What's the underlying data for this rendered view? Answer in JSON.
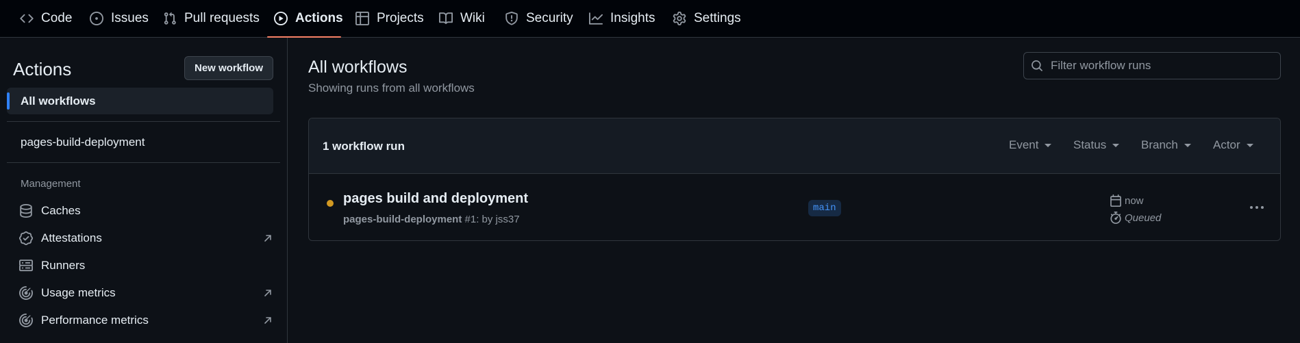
{
  "colors": {
    "background": "#0d1117",
    "nav_background": "#010409",
    "active_tab_underline": "#f78166",
    "active_sidebar_indicator": "#2f81f7",
    "queued_status": "#d29922",
    "branch_text": "#4493f8"
  },
  "nav": {
    "tabs": [
      {
        "label": "Code",
        "icon": "code-icon"
      },
      {
        "label": "Issues",
        "icon": "issue-icon"
      },
      {
        "label": "Pull requests",
        "icon": "pull-request-icon"
      },
      {
        "label": "Actions",
        "icon": "play-icon",
        "active": true
      },
      {
        "label": "Projects",
        "icon": "table-icon"
      },
      {
        "label": "Wiki",
        "icon": "book-icon"
      },
      {
        "label": "Security",
        "icon": "shield-icon"
      },
      {
        "label": "Insights",
        "icon": "graph-icon"
      },
      {
        "label": "Settings",
        "icon": "gear-icon"
      }
    ]
  },
  "sidebar": {
    "title": "Actions",
    "new_workflow_label": "New workflow",
    "all_workflows_label": "All workflows",
    "workflows": [
      "pages-build-deployment"
    ],
    "management_heading": "Management",
    "management_items": [
      {
        "label": "Caches",
        "icon": "database-icon",
        "external": false
      },
      {
        "label": "Attestations",
        "icon": "verified-icon",
        "external": true
      },
      {
        "label": "Runners",
        "icon": "server-icon",
        "external": false
      },
      {
        "label": "Usage metrics",
        "icon": "meter-icon",
        "external": true
      },
      {
        "label": "Performance metrics",
        "icon": "meter-icon",
        "external": true
      }
    ]
  },
  "main": {
    "title": "All workflows",
    "subtitle": "Showing runs from all workflows",
    "filter_placeholder": "Filter workflow runs",
    "runs_count_label": "1 workflow run",
    "filters": [
      "Event",
      "Status",
      "Branch",
      "Actor"
    ],
    "runs": [
      {
        "title": "pages build and deployment",
        "workflow": "pages-build-deployment",
        "meta_suffix": "#1: by jss37",
        "branch": "main",
        "time": "now",
        "status": "Queued"
      }
    ]
  }
}
